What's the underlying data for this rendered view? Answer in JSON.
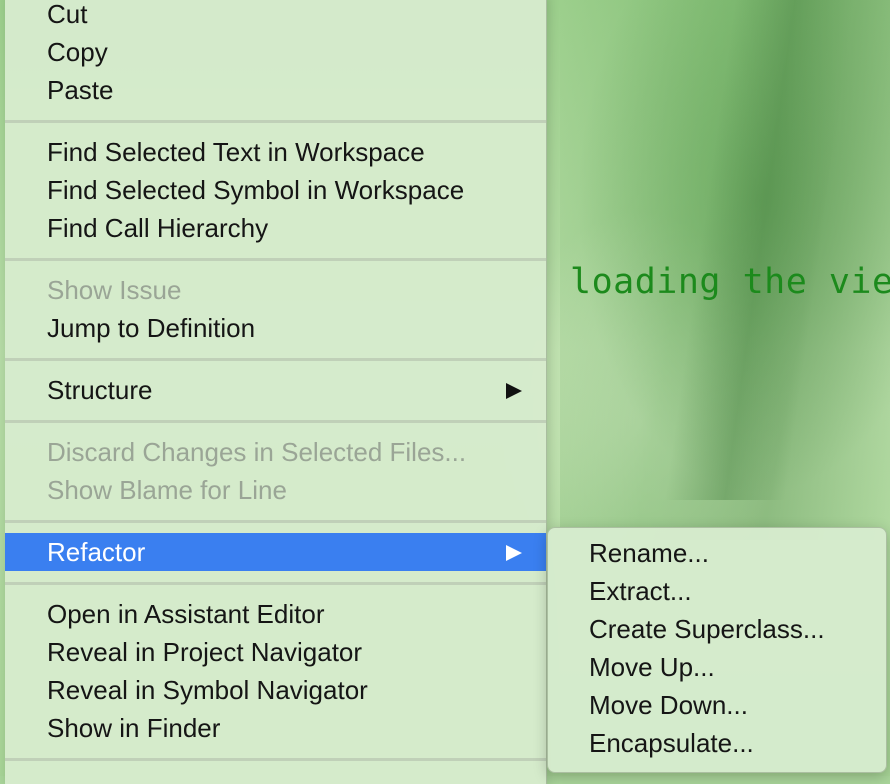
{
  "editor": {
    "code_text": "loading the vie",
    "accent_code": "#1c8a1c"
  },
  "menu": {
    "groups": [
      [
        {
          "label": "Cut",
          "enabled": true
        },
        {
          "label": "Copy",
          "enabled": true
        },
        {
          "label": "Paste",
          "enabled": true
        }
      ],
      [
        {
          "label": "Find Selected Text in Workspace",
          "enabled": true
        },
        {
          "label": "Find Selected Symbol in Workspace",
          "enabled": true
        },
        {
          "label": "Find Call Hierarchy",
          "enabled": true
        }
      ],
      [
        {
          "label": "Show Issue",
          "enabled": false
        },
        {
          "label": "Jump to Definition",
          "enabled": true
        }
      ],
      [
        {
          "label": "Structure",
          "enabled": true,
          "submenu": true,
          "icon": "chevron-right-icon"
        }
      ],
      [
        {
          "label": "Discard Changes in Selected Files...",
          "enabled": false
        },
        {
          "label": "Show Blame for Line",
          "enabled": false
        }
      ],
      [
        {
          "label": "Refactor",
          "enabled": true,
          "submenu": true,
          "selected": true,
          "icon": "chevron-right-icon"
        }
      ],
      [
        {
          "label": "Open in Assistant Editor",
          "enabled": true
        },
        {
          "label": "Reveal in Project Navigator",
          "enabled": true
        },
        {
          "label": "Reveal in Symbol Navigator",
          "enabled": true
        },
        {
          "label": "Show in Finder",
          "enabled": true
        }
      ]
    ],
    "selection_color": "#3a7ff0"
  },
  "submenu": {
    "items": [
      {
        "label": "Rename..."
      },
      {
        "label": "Extract..."
      },
      {
        "label": "Create Superclass..."
      },
      {
        "label": "Move Up..."
      },
      {
        "label": "Move Down..."
      },
      {
        "label": "Encapsulate..."
      }
    ]
  }
}
